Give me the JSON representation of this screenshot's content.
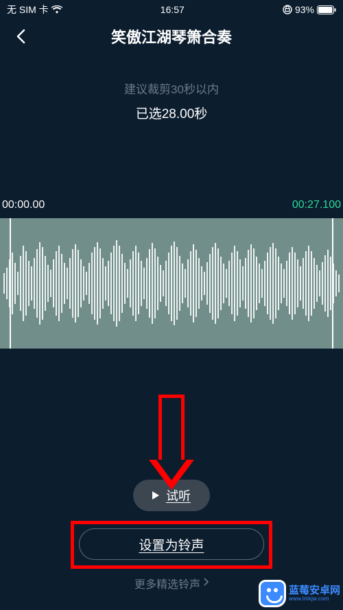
{
  "status_bar": {
    "carrier": "无 SIM 卡",
    "time": "16:57",
    "battery_pct": "93%"
  },
  "nav": {
    "title": "笑傲江湖琴箫合奏"
  },
  "trim": {
    "hint": "建议裁剪30秒以内",
    "selected": "已选28.00秒",
    "start_time": "00:00.00",
    "end_time": "00:27.100"
  },
  "buttons": {
    "preview": "试听",
    "set_ringtone": "设置为铃声",
    "more": "更多精选铃声"
  },
  "watermark": {
    "name_cn": "蓝莓安卓网",
    "name_en": "www.lmkjw.com"
  }
}
